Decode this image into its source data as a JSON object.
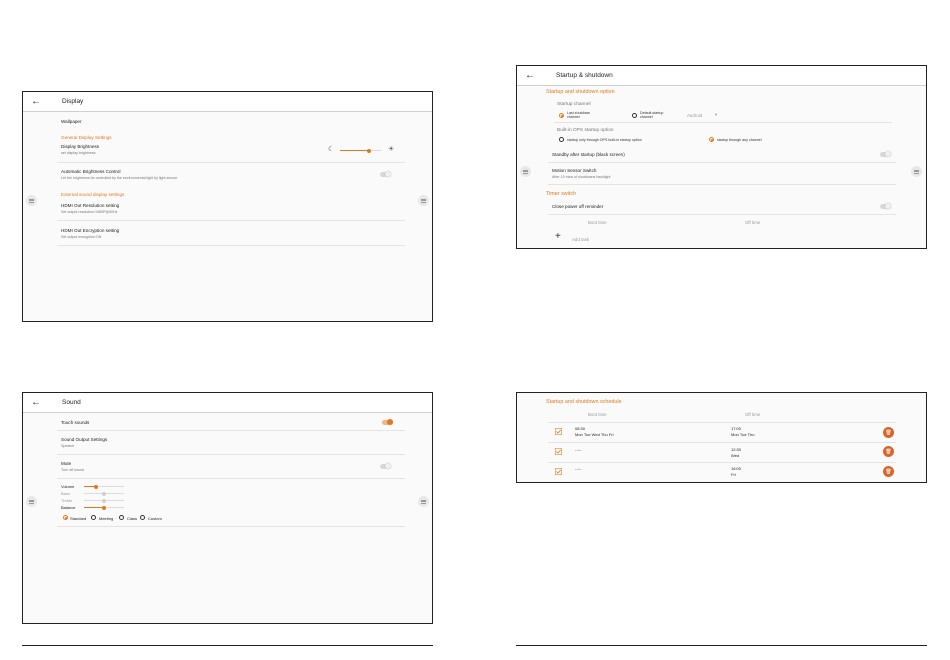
{
  "display": {
    "title": "Display",
    "wallpaper": "Wallpaper",
    "general_section": "General Display Settings",
    "brightness_title": "Display Brightness",
    "brightness_sub": "set display brightness",
    "brightness_level": 0.68,
    "auto_title": "Automatic Brightness Control",
    "auto_sub": "Let the brightness be controlled by the environmental light by light sensor",
    "external_section": "External sound display settings",
    "hdmi_res_title": "HDMI Out Resolution setting",
    "hdmi_res_sub": "Set output resolution:1080P@60Hz",
    "hdmi_enc_title": "HDMI Out Encryption setting",
    "hdmi_enc_sub": "Set output encryption:ON"
  },
  "startup": {
    "title": "Startup & shutdown",
    "option_section": "Startup and shutdown option",
    "channel_label": "Startup channel",
    "last_channel": "Last shutdown\nchannel",
    "default_channel": "Default startup\nchannel",
    "android_value": "Android",
    "ops_label": "Built-in OPS startup option",
    "ops_only": "startup only through OPS built-in startup option",
    "ops_any": "startup through any channel",
    "standby_label": "Standby after startup (black screen)",
    "motion_title": "Motion Sensor Switch",
    "motion_sub": "After 15 mins of shutdowns backlight",
    "timer_section": "Timer switch",
    "close_reminder": "Close power off reminder",
    "boot_time": "Boot time",
    "off_time": "Off time",
    "add_task": "Add task"
  },
  "sound": {
    "title": "Sound",
    "touch_sounds": "Touch sounds",
    "output_title": "Sound Output Settings",
    "output_sub": "Speaker",
    "mute_title": "Mute",
    "mute_sub": "Turn off sound",
    "volume": "Volume",
    "bass": "Bass",
    "treble": "Treble",
    "balance": "Balance",
    "volume_level": 0.3,
    "bass_level": 0.5,
    "treble_level": 0.5,
    "balance_level": 0.5,
    "modes": [
      "Standard",
      "Meeting",
      "Class",
      "Custom"
    ]
  },
  "schedule": {
    "section": "Startup and shutdown schedule",
    "boot_time": "Boot time",
    "off_time": "Off time",
    "rows": [
      {
        "boot": "08:30",
        "boot_days": "Mon Tue Wed Thu Fri",
        "off": "17:00",
        "off_days": "Mon Tue Thu"
      },
      {
        "boot": "--:--",
        "boot_days": "",
        "off": "12:30",
        "off_days": "Wed"
      },
      {
        "boot": "--:--",
        "boot_days": "",
        "off": "16:00",
        "off_days": "Fri"
      }
    ]
  },
  "colors": {
    "accent": "#e07a1f",
    "delete": "#d9652a"
  },
  "icons": [
    "back-arrow-icon",
    "moon-icon",
    "sun-icon",
    "drag-handle-icon",
    "plus-icon",
    "checkbox-icon",
    "trash-icon"
  ]
}
